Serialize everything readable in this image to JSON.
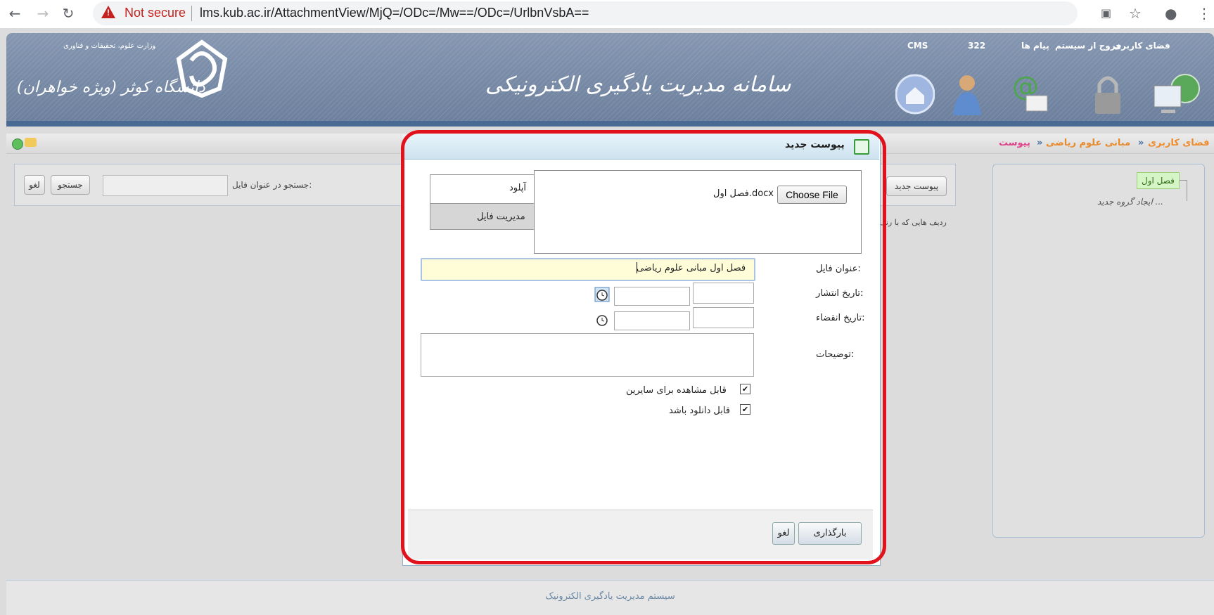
{
  "browser": {
    "security": "Not secure",
    "url": "lms.kub.ac.ir/AttachmentView/MjQ=/ODc=/Mw==/ODc=/UrlbnVsbA=="
  },
  "header": {
    "links": {
      "user_space": "فضای کاربری",
      "logout": "خروج از سیستم",
      "messages": "پیام ها",
      "count": "322",
      "cms": "CMS"
    },
    "system_title": "سامانه مدیریت یادگیری الکترونیکی",
    "university_name": "دانشگاه کوثر (ویژه خواهران)",
    "ministry": "وزارت علوم، تحقیقات و فناوری"
  },
  "breadcrumb": {
    "user_space": "فضای کاربری",
    "course": "مبانی علوم ریاضی",
    "current": "پیوست",
    "separator": "»"
  },
  "tree": {
    "item": "فصل اول",
    "new_group": "ایجاد گروه جدید ..."
  },
  "search": {
    "label": "جستجو در عنوان فایل:",
    "search_button": "جستجو",
    "cancel_button": "لغو"
  },
  "toolbar": {
    "new_attachment": "پیوست جدید",
    "row_note": "ردیف هایی که با رنگ"
  },
  "dialog": {
    "title": "پیوست جدید",
    "tabs": {
      "upload": "آپلود",
      "manage": "مدیریت فایل"
    },
    "choose_file": "Choose File",
    "file_name": "فصل اول.docx",
    "labels": {
      "file_title": "عنوان فایل:",
      "publish_date": "تاریخ انتشار:",
      "expire_date": "تاریخ انقضاء:",
      "description": "توضیحات:"
    },
    "file_title_value": "فصل اول مبانی علوم ریاضی",
    "visible_to_others": "قابل مشاهده برای سایرین",
    "downloadable": "قابل دانلود باشد",
    "buttons": {
      "upload": "بارگذاری",
      "cancel": "لغو"
    }
  },
  "footer": {
    "text": "سیستم مدیریت یادگیری الکترونیک"
  },
  "colors": {
    "accent_red": "#e0121b",
    "header": "#7d8ea8",
    "link_orange": "#ffb84d"
  }
}
